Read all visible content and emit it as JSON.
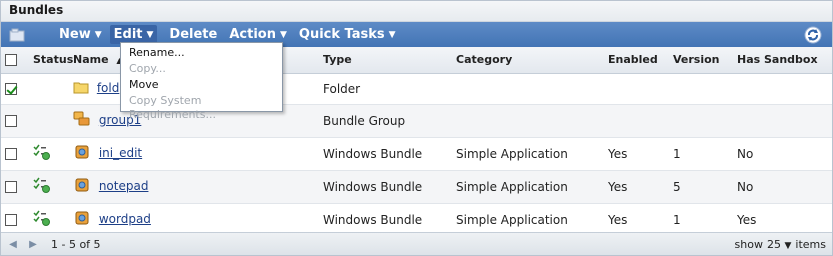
{
  "panel": {
    "title": "Bundles"
  },
  "toolbar": {
    "new_label": "New",
    "edit_label": "Edit",
    "delete_label": "Delete",
    "action_label": "Action",
    "quick_tasks_label": "Quick Tasks"
  },
  "edit_menu": {
    "items": [
      {
        "label": "Rename...",
        "enabled": true
      },
      {
        "label": "Copy...",
        "enabled": false
      },
      {
        "label": "Move",
        "enabled": true
      },
      {
        "label": "Copy System Requirements...",
        "enabled": false
      }
    ]
  },
  "table": {
    "headers": {
      "status": "Status",
      "name": "Name",
      "type": "Type",
      "category": "Category",
      "enabled": "Enabled",
      "version": "Version",
      "has_sandbox": "Has Sandbox"
    },
    "rows": [
      {
        "checked": true,
        "icon": "folder-icon",
        "name": "fold",
        "type": "Folder",
        "category": "",
        "enabled": "",
        "version": "",
        "sandbox": ""
      },
      {
        "checked": false,
        "icon": "bundle-group-icon",
        "name": "group1",
        "type": "Bundle Group",
        "category": "",
        "enabled": "",
        "version": "",
        "sandbox": ""
      },
      {
        "checked": false,
        "icon": "bundle-icon",
        "name": "ini_edit",
        "type": "Windows Bundle",
        "category": "Simple Application",
        "enabled": "Yes",
        "version": "1",
        "sandbox": "No"
      },
      {
        "checked": false,
        "icon": "bundle-icon",
        "name": "notepad",
        "type": "Windows Bundle",
        "category": "Simple Application",
        "enabled": "Yes",
        "version": "5",
        "sandbox": "No"
      },
      {
        "checked": false,
        "icon": "bundle-icon",
        "name": "wordpad",
        "type": "Windows Bundle",
        "category": "Simple Application",
        "enabled": "Yes",
        "version": "1",
        "sandbox": "Yes"
      }
    ]
  },
  "footer": {
    "range": "1 - 5 of 5",
    "show_label": "show",
    "page_size": "25",
    "items_label": "items"
  }
}
